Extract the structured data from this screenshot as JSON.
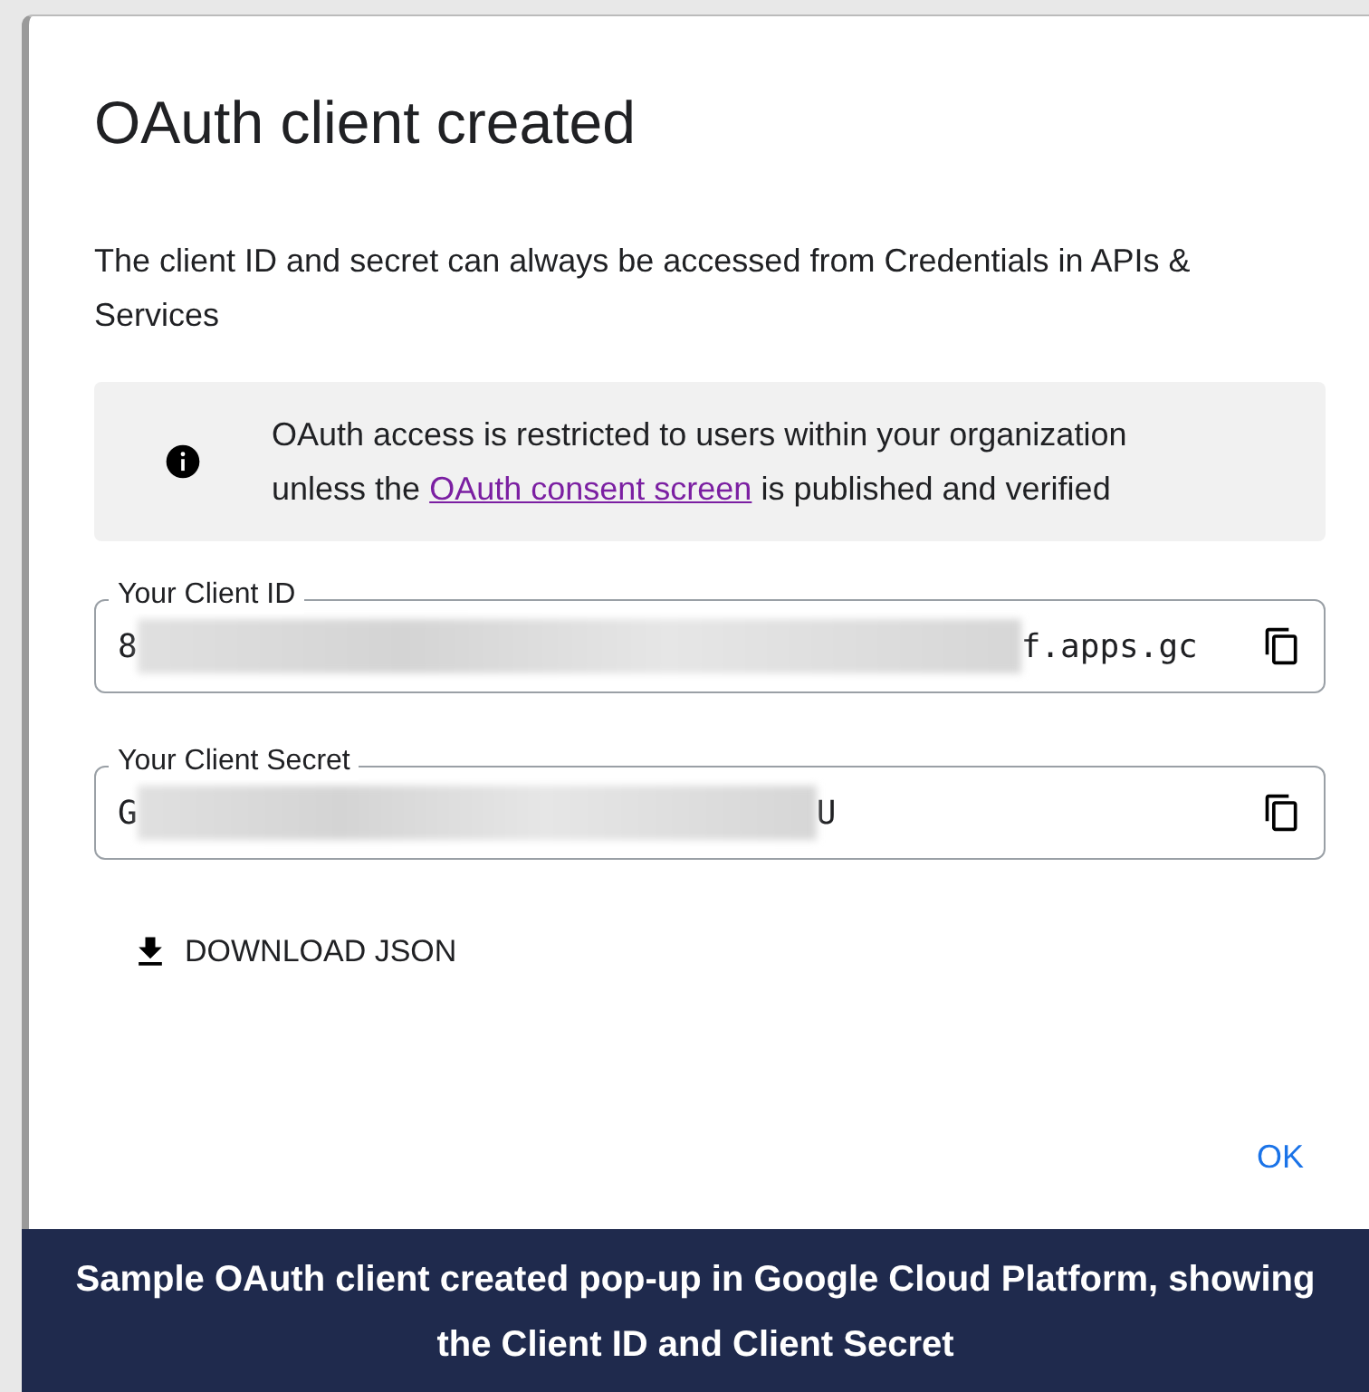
{
  "dialog": {
    "title": "OAuth client created",
    "description": "The client ID and secret can always be accessed from Credentials in APIs & Services",
    "notice": {
      "text_before": "OAuth access is restricted to users within your organization unless the",
      "link": "OAuth consent screen",
      "text_after": "is published and verified"
    },
    "fields": [
      {
        "label": "Your Client ID",
        "value_start": "8",
        "value_end": "f.apps.gc"
      },
      {
        "label": "Your Client Secret",
        "value_start": "G",
        "value_end": "U"
      }
    ],
    "download_button": "DOWNLOAD JSON",
    "ok_button": "OK"
  },
  "caption": "Sample OAuth client created pop-up in Google Cloud Platform, showing the Client ID and Client Secret"
}
